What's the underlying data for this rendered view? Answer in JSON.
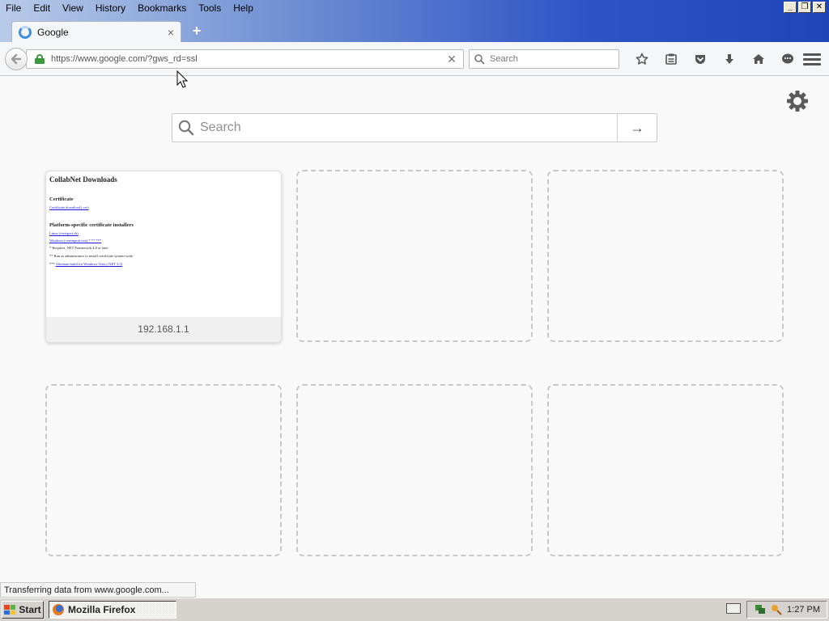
{
  "menubar": {
    "items": [
      "File",
      "Edit",
      "View",
      "History",
      "Bookmarks",
      "Tools",
      "Help"
    ]
  },
  "window_controls": {
    "minimize": "_",
    "restore": "❐",
    "close": "✕"
  },
  "tab": {
    "title": "Google",
    "close": "×",
    "new_tab": "+"
  },
  "navbar": {
    "url": "https://www.google.com/?gws_rd=ssl",
    "url_clear": "✕",
    "search_placeholder": "Search",
    "back_icon": "arrow-left-icon",
    "icons": [
      "star-icon",
      "reading-list-icon",
      "pocket-icon",
      "download-icon",
      "home-icon",
      "chat-icon"
    ]
  },
  "newtab": {
    "search_placeholder": "Search",
    "go": "→",
    "tiles": [
      {
        "label": "192.168.1.1",
        "thumbnail": {
          "heading": "CollabNet Downloads",
          "section1": "Certificate",
          "link1": "Certificate download (.cer)",
          "section2": "Platform-specific certificate installers",
          "link2": "Linux (certsport.sh)",
          "link3": "Windows (certimport.exe) * ** ***",
          "note1": "* Requires .NET Framework 4.0 or later",
          "note2": "** Run as administrator to install certificate system-wide",
          "note3_prefix": "***",
          "note3_link": "Alternate build for Windows Vista (.NET 3.5)"
        }
      },
      {
        "label": ""
      },
      {
        "label": ""
      },
      {
        "label": ""
      },
      {
        "label": ""
      },
      {
        "label": ""
      }
    ]
  },
  "status": "Transferring data from www.google.com...",
  "taskbar": {
    "start": "Start",
    "task": "Mozilla Firefox",
    "clock": "1:27 PM"
  },
  "colors": {
    "accent": "#2d55c6",
    "lock": "#3b9a3b",
    "link": "#1b1bd8"
  }
}
